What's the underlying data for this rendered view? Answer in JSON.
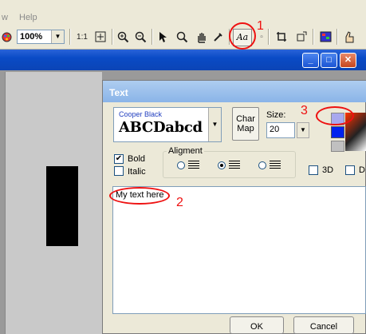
{
  "menu": {
    "items": [
      "w",
      "Help"
    ]
  },
  "toolbar": {
    "zoom_value": "100%",
    "ratio_label": "1:1",
    "text_tool_label": "Aa"
  },
  "window_buttons": {
    "minimize": "_",
    "maximize": "□",
    "close": "✕"
  },
  "dialog": {
    "title": "Text",
    "font_name": "Cooper Black",
    "font_sample": "ABCDabcd",
    "charmap_label_1": "Char",
    "charmap_label_2": "Map",
    "size_label": "Size:",
    "size_value": "20",
    "bold_label": "Bold",
    "bold_checked": true,
    "italic_label": "Italic",
    "italic_checked": false,
    "alignment_label": "Aligment",
    "alignment_selected": "center",
    "cb_3d_label": "3D",
    "cb_d_label": "D",
    "text_value": "My text here",
    "ok_label": "OK",
    "cancel_label": "Cancel",
    "color_primary": "#a8a8ee",
    "color_secondary": "#0022ee"
  },
  "annotations": {
    "one": "1",
    "two": "2",
    "three": "3"
  },
  "icons": [
    "palette-icon",
    "zoom-in-icon",
    "zoom-out-icon",
    "pointer-icon",
    "magnifier-icon",
    "hand-icon",
    "eyedropper-icon",
    "text-tool-icon",
    "crop-icon",
    "resize-icon",
    "color-icon",
    "thumb-icon"
  ]
}
